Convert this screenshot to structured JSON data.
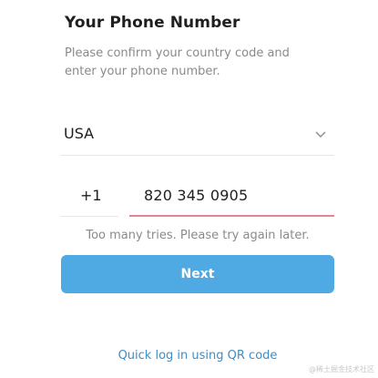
{
  "header": {
    "title": "Your Phone Number",
    "subtitle": "Please confirm your country code and enter your phone number."
  },
  "country": {
    "selected": "USA",
    "icon": "chevron-down-icon"
  },
  "phone": {
    "country_code": "+1",
    "number": "820 345 0905"
  },
  "error_message": "Too many tries. Please try again later.",
  "next_button_label": "Next",
  "qr_login_link": "Quick log in using QR code",
  "watermark": "@稀土掘金技术社区",
  "colors": {
    "accent": "#4fa9e3",
    "link": "#3d8ec9",
    "error_underline": "#e5838e"
  }
}
